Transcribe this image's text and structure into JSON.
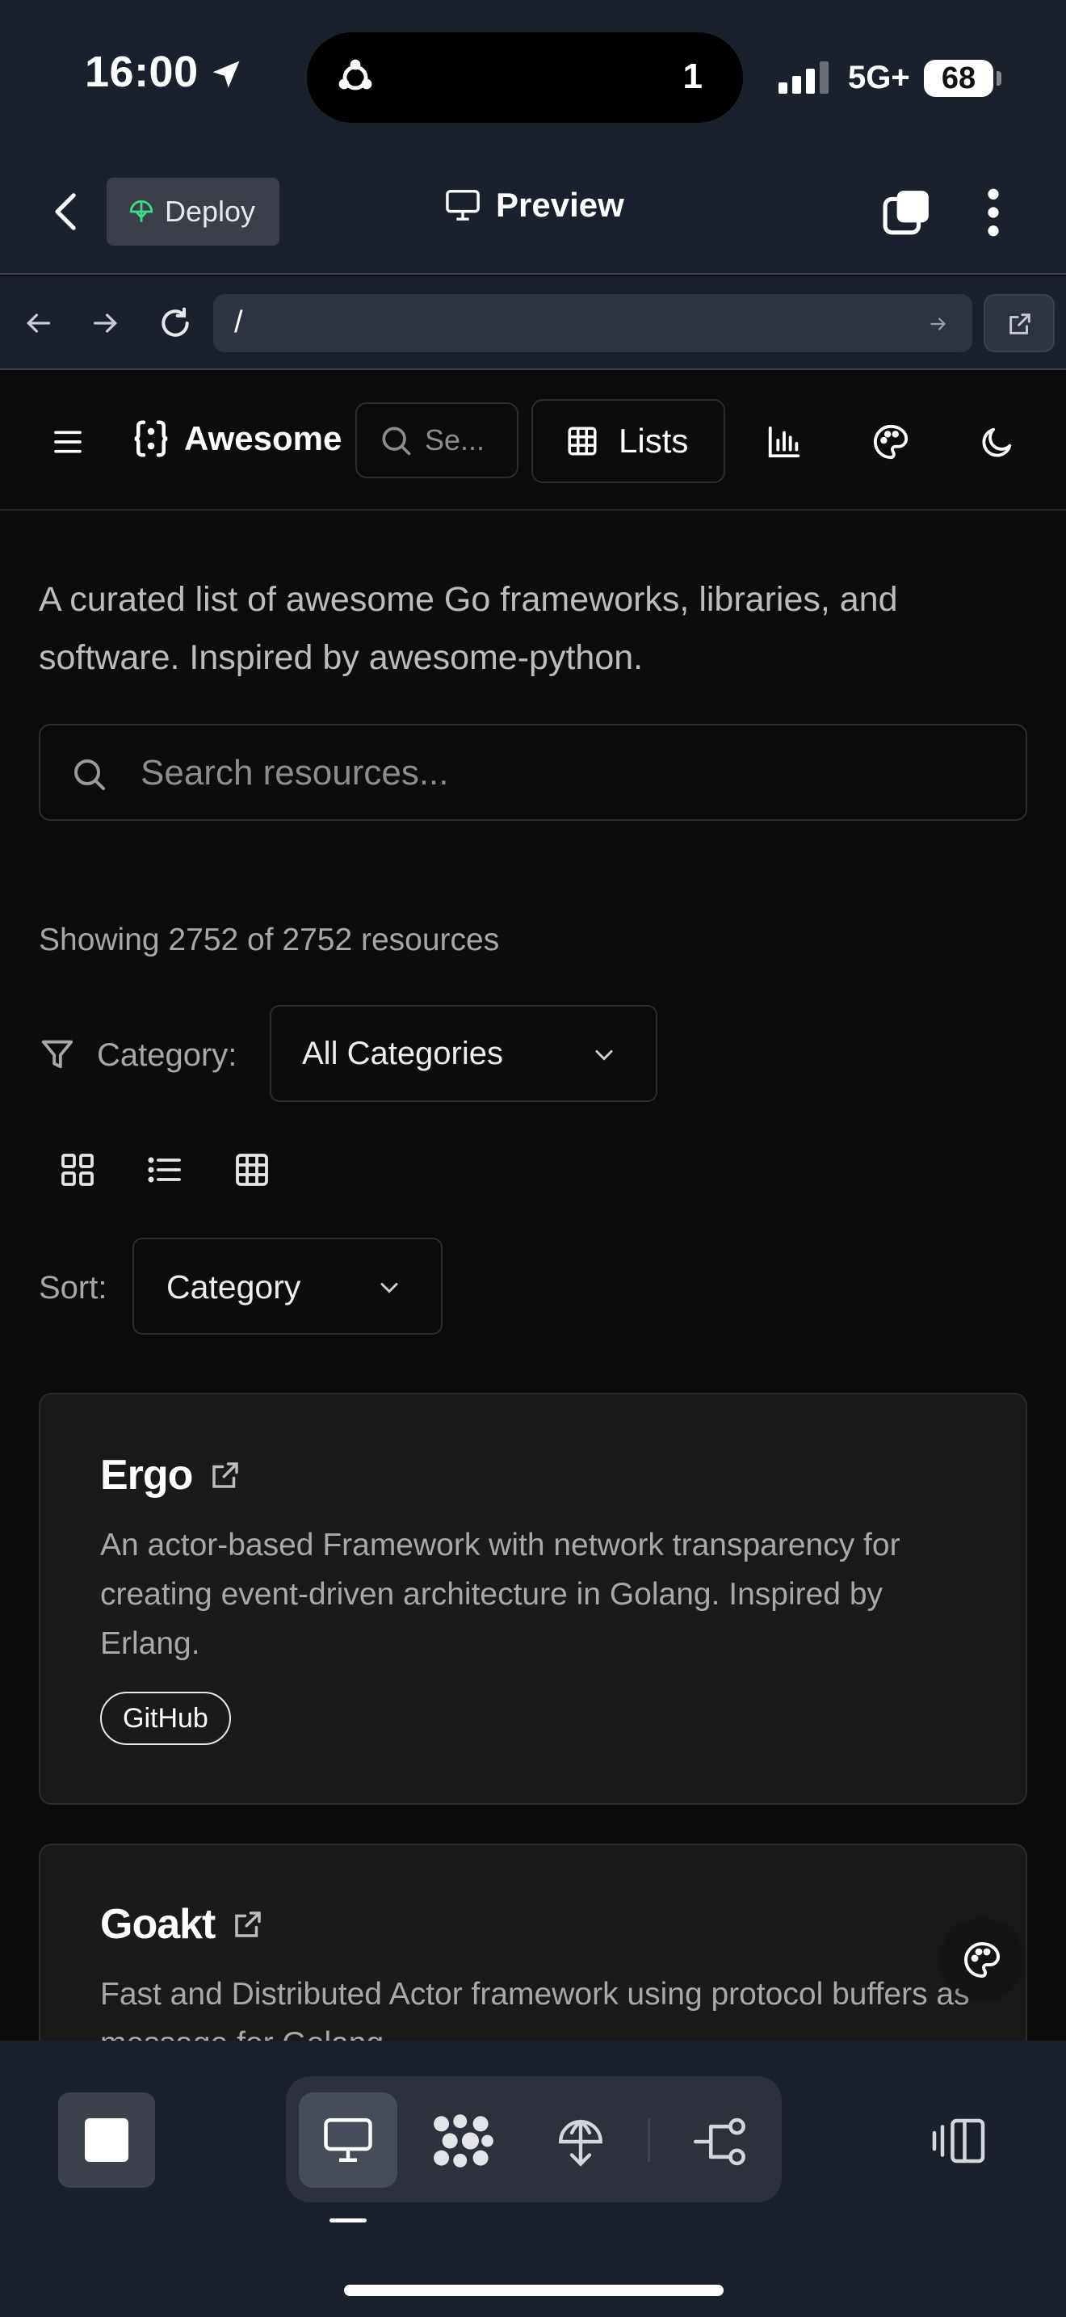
{
  "status_bar": {
    "time": "16:00",
    "island_count": "1",
    "network": "5G+",
    "battery": "68"
  },
  "header": {
    "deploy_label": "Deploy",
    "title": "Preview"
  },
  "browser": {
    "url": "/"
  },
  "nav": {
    "brand": "Awesome",
    "search_placeholder": "Se...",
    "lists_label": "Lists"
  },
  "main": {
    "description": "A curated list of awesome Go frameworks, libraries, and software. Inspired by awesome-python.",
    "search_placeholder": "Search resources...",
    "showing_text": "Showing 2752 of 2752 resources",
    "category_label": "Category:",
    "category_value": "All Categories",
    "sort_label": "Sort:",
    "sort_value": "Category",
    "cards": [
      {
        "title": "Ergo",
        "description": "An actor-based Framework with network transparency for creating event-driven architecture in Golang. Inspired by Erlang.",
        "tag": "GitHub"
      },
      {
        "title": "Goakt",
        "description": "Fast and Distributed Actor framework using protocol buffers as message for Golang."
      }
    ]
  },
  "colors": {
    "background": "#0d0c0c",
    "chrome": "#1a202c",
    "card": "#1c1a19",
    "deploy_icon": "#3ddc84"
  }
}
